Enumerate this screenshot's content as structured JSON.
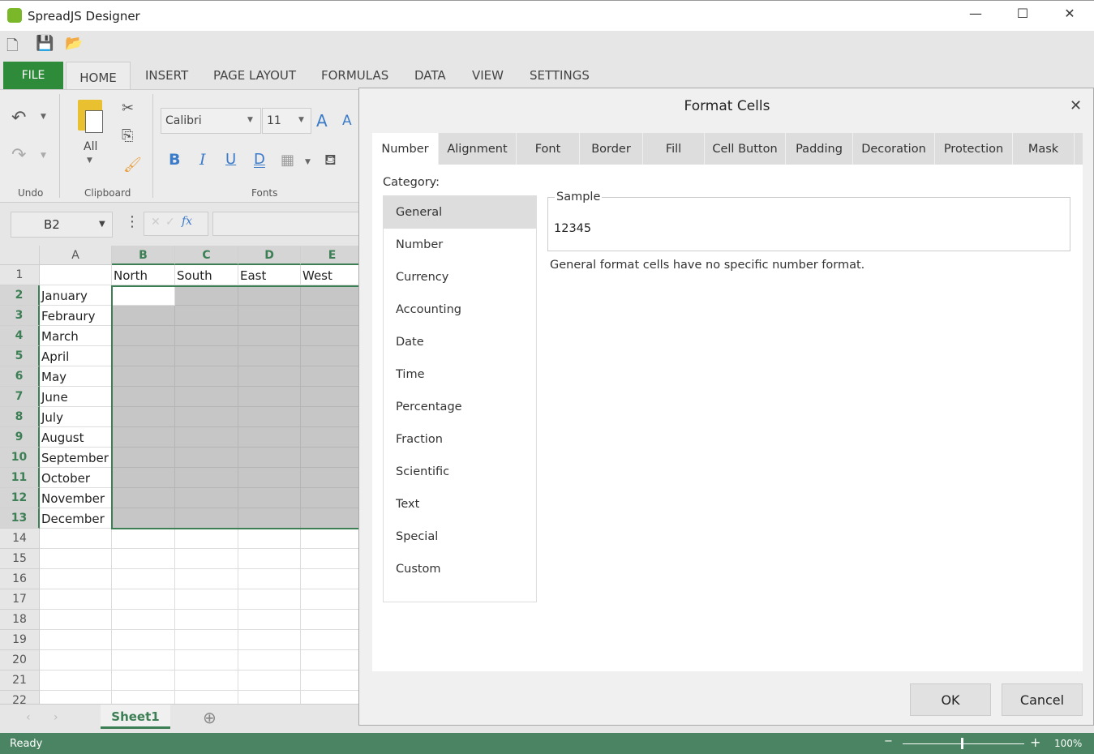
{
  "window": {
    "title": "SpreadJS Designer",
    "minimize": "—",
    "maximize": "☐",
    "close": "✕"
  },
  "ribbon": {
    "tabs": {
      "file": "FILE",
      "home": "HOME",
      "others": [
        "INSERT",
        "PAGE LAYOUT",
        "FORMULAS",
        "DATA",
        "VIEW",
        "SETTINGS"
      ]
    },
    "groups": {
      "undo": "Undo",
      "clipboard": "Clipboard",
      "fonts": "Fonts"
    },
    "paste_label": "All",
    "font_name": "Calibri",
    "font_size": "11",
    "bold": "B",
    "italic": "I",
    "underline": "U",
    "double_underline": "D"
  },
  "formula_bar": {
    "name_box": "B2",
    "fx": "fx",
    "value": ""
  },
  "sheet": {
    "columns": [
      "A",
      "B",
      "C",
      "D",
      "E"
    ],
    "selected_columns": [
      "B",
      "C",
      "D",
      "E"
    ],
    "rows": [
      [
        "",
        "North",
        "South",
        "East",
        "West"
      ],
      [
        "January",
        "",
        "",
        "",
        ""
      ],
      [
        "Febraury",
        "",
        "",
        "",
        ""
      ],
      [
        "March",
        "",
        "",
        "",
        ""
      ],
      [
        "April",
        "",
        "",
        "",
        ""
      ],
      [
        "May",
        "",
        "",
        "",
        ""
      ],
      [
        "June",
        "",
        "",
        "",
        ""
      ],
      [
        "July",
        "",
        "",
        "",
        ""
      ],
      [
        "August",
        "",
        "",
        "",
        ""
      ],
      [
        "September",
        "",
        "",
        "",
        ""
      ],
      [
        "October",
        "",
        "",
        "",
        ""
      ],
      [
        "November",
        "",
        "",
        "",
        ""
      ],
      [
        "December",
        "",
        "",
        "",
        ""
      ],
      [
        "",
        "",
        "",
        "",
        ""
      ],
      [
        "",
        "",
        "",
        "",
        ""
      ],
      [
        "",
        "",
        "",
        "",
        ""
      ],
      [
        "",
        "",
        "",
        "",
        ""
      ],
      [
        "",
        "",
        "",
        "",
        ""
      ],
      [
        "",
        "",
        "",
        "",
        ""
      ],
      [
        "",
        "",
        "",
        "",
        ""
      ],
      [
        "",
        "",
        "",
        "",
        ""
      ],
      [
        "",
        "",
        "",
        "",
        ""
      ]
    ],
    "tab": "Sheet1"
  },
  "status": {
    "text": "Ready",
    "zoom": "100%"
  },
  "dialog": {
    "title": "Format Cells",
    "tabs": [
      "Number",
      "Alignment",
      "Font",
      "Border",
      "Fill",
      "Cell Button",
      "Padding",
      "Decoration",
      "Protection",
      "Mask"
    ],
    "active_tab": "Number",
    "category_label": "Category:",
    "categories": [
      "General",
      "Number",
      "Currency",
      "Accounting",
      "Date",
      "Time",
      "Percentage",
      "Fraction",
      "Scientific",
      "Text",
      "Special",
      "Custom"
    ],
    "selected_category": "General",
    "sample_label": "Sample",
    "sample_value": "12345",
    "description": "General format cells have no specific number format.",
    "ok": "OK",
    "cancel": "Cancel"
  },
  "colors": {
    "accent": "#3d7f55",
    "file_tab": "#2e8b3a",
    "status_bar": "#4a8462"
  }
}
